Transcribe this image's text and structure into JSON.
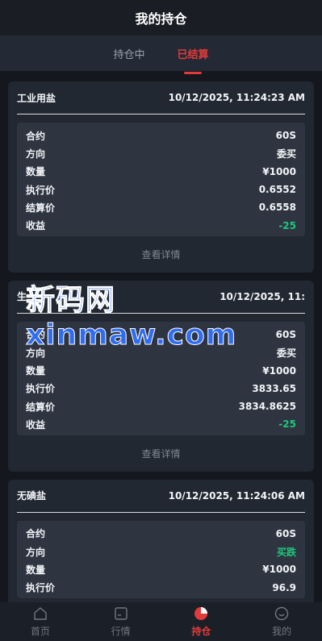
{
  "header": {
    "title": "我的持仓"
  },
  "tabs": [
    {
      "label": "持仓中",
      "active": false
    },
    {
      "label": "已结算",
      "active": true
    }
  ],
  "cards": [
    {
      "name": "工业用盐",
      "time": "10/12/2025, 11:24:23 AM",
      "rows": [
        {
          "label": "合约",
          "value": "60S"
        },
        {
          "label": "方向",
          "value": "委买"
        },
        {
          "label": "数量",
          "value": "¥1000"
        },
        {
          "label": "执行价",
          "value": "0.6552"
        },
        {
          "label": "结算价",
          "value": "0.6558"
        },
        {
          "label": "收益",
          "value": "-25"
        }
      ],
      "link": "查看详情"
    },
    {
      "name": "生",
      "time": "10/12/2025, 11:",
      "rows": [
        {
          "label": "合约",
          "value": "60S"
        },
        {
          "label": "方向",
          "value": "委买"
        },
        {
          "label": "数量",
          "value": "¥1000"
        },
        {
          "label": "执行价",
          "value": "3833.65"
        },
        {
          "label": "结算价",
          "value": "3834.8625"
        },
        {
          "label": "收益",
          "value": "-25"
        }
      ],
      "link": "查看详情"
    },
    {
      "name": "无碘盐",
      "time": "10/12/2025, 11:24:06 AM",
      "rows": [
        {
          "label": "合约",
          "value": "60S"
        },
        {
          "label": "方向",
          "value": "买跌"
        },
        {
          "label": "数量",
          "value": "¥1000"
        },
        {
          "label": "执行价",
          "value": "96.9"
        }
      ],
      "link": ""
    }
  ],
  "watermark": "新码网xinmaw.com",
  "nav": [
    {
      "label": "首页",
      "icon": "home-icon"
    },
    {
      "label": "行情",
      "icon": "market-icon"
    },
    {
      "label": "持仓",
      "icon": "position-pie-icon",
      "active": true
    },
    {
      "label": "我的",
      "icon": "profile-icon"
    }
  ],
  "colors": {
    "accent": "#e23a3a",
    "positive": "#1fc87c",
    "background": "#14171d",
    "card": "#222831"
  }
}
